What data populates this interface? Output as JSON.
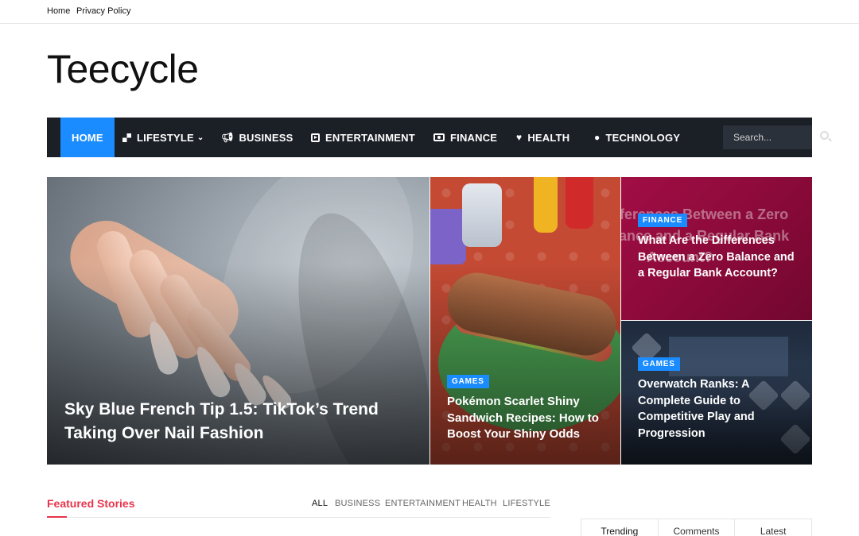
{
  "topbar": {
    "links": [
      "Home",
      "Privacy Policy"
    ]
  },
  "site": {
    "logo": "Teecycle"
  },
  "nav": {
    "items": [
      {
        "label": "HOME",
        "icon": ""
      },
      {
        "label": "LIFESTYLE",
        "icon": "grid-icon",
        "caret": "⌄"
      },
      {
        "label": "BUSINESS",
        "icon": "megaphone-icon"
      },
      {
        "label": "ENTERTAINMENT",
        "icon": "play-box-icon"
      },
      {
        "label": "FINANCE",
        "icon": "money-icon"
      },
      {
        "label": "HEALTH",
        "icon": "heart-pulse-icon"
      },
      {
        "label": "TECHNOLOGY",
        "icon": "apple-icon"
      }
    ],
    "search_placeholder": "Search...",
    "accent": "#1a8cff",
    "bg": "#1b1f26"
  },
  "hero": [
    {
      "title": "Sky Blue French Tip 1.5: TikTok’s Trend Taking Over Nail Fashion",
      "category": ""
    },
    {
      "title": "Pokémon Scarlet Shiny Sandwich Recipes: How to Boost Your Shiny Odds",
      "category": "GAMES"
    },
    {
      "title": "What Are the Differences Between a Zero Balance and a Regular Bank Account?",
      "category": "FINANCE",
      "image_text": [
        "fferences Between a Zero",
        "lance and a Regular Bank",
        "Account?"
      ]
    },
    {
      "title": "Overwatch Ranks: A Complete Guide to Competitive Play and Progression",
      "category": "GAMES"
    }
  ],
  "featured": {
    "title": "Featured Stories",
    "filters": [
      "ALL",
      "BUSINESS",
      "ENTERTAINMENT",
      "HEALTH",
      "LIFESTYLE"
    ],
    "accent": "#e8344b"
  },
  "sidebar_tabs": [
    "Trending",
    "Comments",
    "Latest"
  ]
}
